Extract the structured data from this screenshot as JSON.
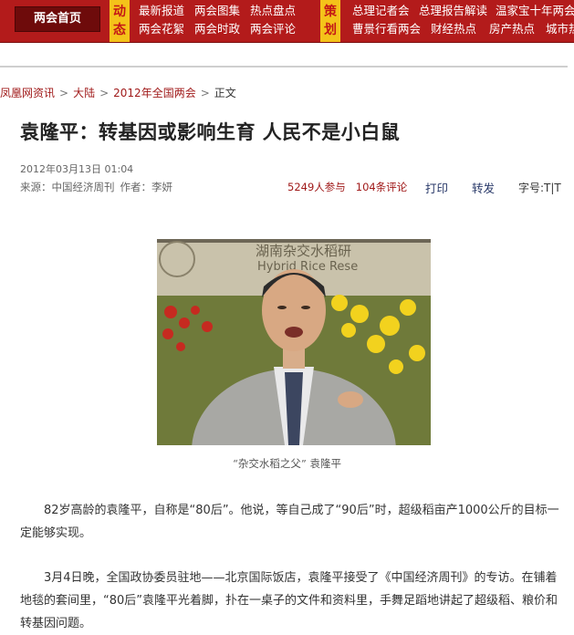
{
  "nav": {
    "home": "两会首页",
    "tag1": "动态",
    "tag2": "策划",
    "row1": [
      "最新报道",
      "两会图集",
      "热点盘点"
    ],
    "row2": [
      "两会花絮",
      "两会时政",
      "两会评论"
    ],
    "row3": [
      "总理记者会",
      "总理报告解读",
      "温家宝十年两会"
    ],
    "row4": [
      "曹景行看两会",
      "财经热点",
      "房产热点",
      "城市热"
    ]
  },
  "breadcrumb": {
    "items": [
      "凤凰网资讯",
      "大陆",
      "2012年全国两会"
    ],
    "current": "正文",
    "separator": ">"
  },
  "article": {
    "title": "袁隆平：转基因或影响生育 人民不是小白鼠",
    "date": "2012年03月13日 01:04",
    "source": "来源：中国经济周刊",
    "author": "作者：李妍",
    "participants": "5249人参与",
    "comments": "104条评论",
    "print": "打印",
    "forward": "转发",
    "font_size": "字号:T|T",
    "photo_caption": "“杂交水稻之父” 袁隆平",
    "photo_sign": "湖南杂交水稻研",
    "photo_sign2": "Hybrid Rice Rese",
    "p1": "82岁高龄的袁隆平，自称是“80后”。他说，等自己成了“90后”时，超级稻亩产1000公斤的目标一定能够实现。",
    "p2": "3月4日晚，全国政协委员驻地——北京国际饭店，袁隆平接受了《中国经济周刊》的专访。在铺着地毯的套间里，“80后”袁隆平光着脚，扑在一桌子的文件和资料里，手舞足蹈地讲起了超级稻、粮价和转基因问题。"
  }
}
